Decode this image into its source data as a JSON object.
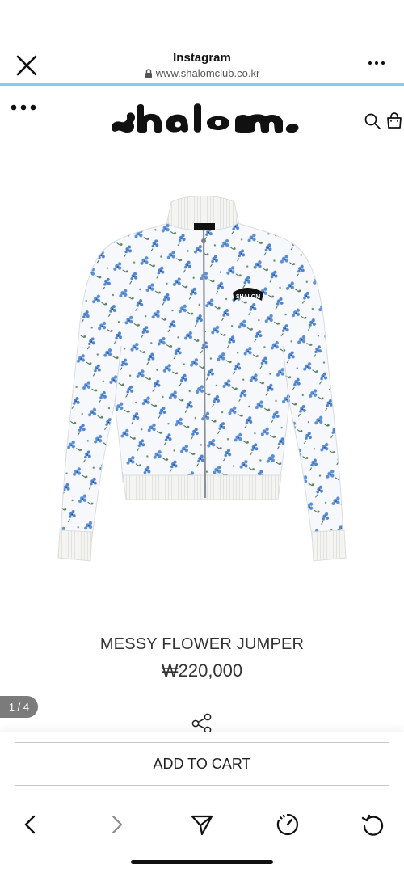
{
  "browser": {
    "title": "Instagram",
    "url": "www.shalomclub.co.kr",
    "accent_color": "#89cbee"
  },
  "site": {
    "logo_text": "shalom",
    "icons": [
      "more-dots-icon",
      "search-icon",
      "shopping-bag-icon"
    ]
  },
  "gallery": {
    "counter": "1 / 4",
    "chest_logo_text": "SHALOM"
  },
  "product": {
    "name": "MESSY FLOWER JUMPER",
    "price": "₩220,000"
  },
  "cart": {
    "add_to_cart_label": "ADD TO CART"
  },
  "toolbar": {
    "icons": [
      "back-arrow-icon",
      "forward-arrow-icon",
      "send-icon",
      "speed-gauge-icon",
      "refresh-icon"
    ]
  }
}
